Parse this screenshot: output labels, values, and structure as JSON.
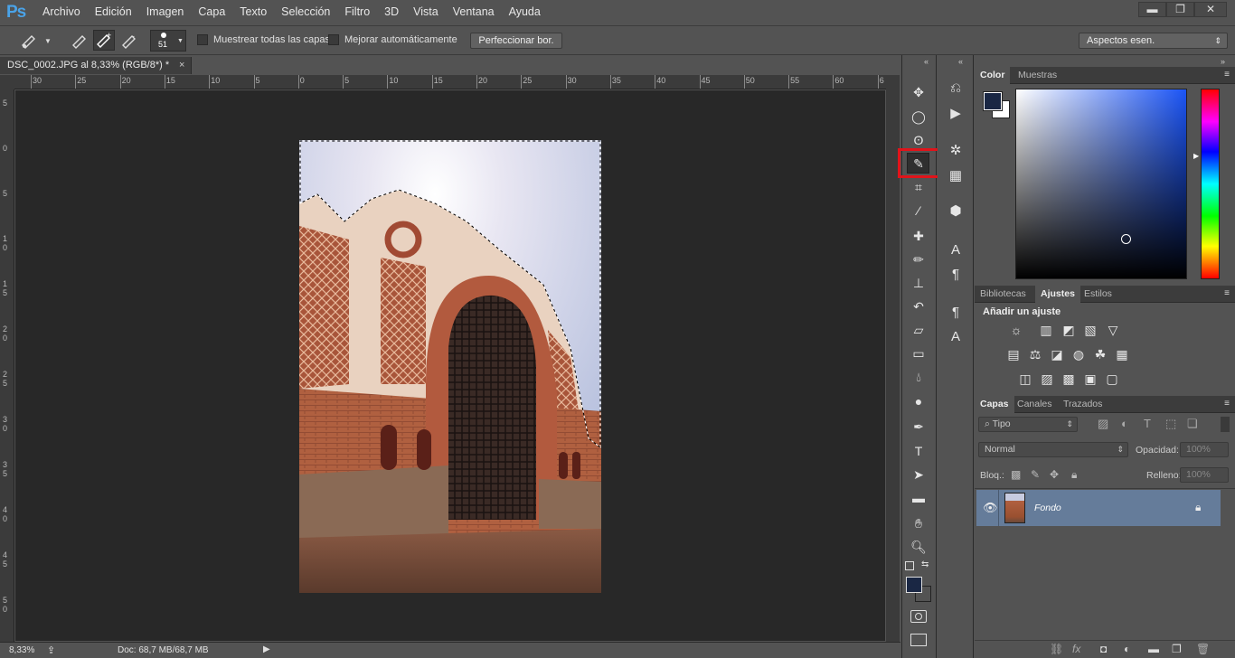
{
  "app": {
    "logo": "Ps"
  },
  "menu": [
    "Archivo",
    "Edición",
    "Imagen",
    "Capa",
    "Texto",
    "Selección",
    "Filtro",
    "3D",
    "Vista",
    "Ventana",
    "Ayuda"
  ],
  "window_controls": {
    "minimize": "▬",
    "restore": "❐",
    "close": "✕"
  },
  "options": {
    "brush_size": "51",
    "sample_all_layers": "Muestrear todas las capas",
    "auto_enhance": "Mejorar automáticamente",
    "refine_edge": "Perfeccionar bor.",
    "workspace": "Aspectos esen."
  },
  "document": {
    "tab_title": "DSC_0002.JPG al 8,33% (RGB/8*) *",
    "close": "×",
    "zoom": "8,33%",
    "doc_info": "Doc: 68,7 MB/68,7 MB"
  },
  "rulers": {
    "h_labels": [
      "30",
      "25",
      "20",
      "15",
      "10",
      "5",
      "0",
      "5",
      "10",
      "15",
      "20",
      "25",
      "30",
      "35",
      "40",
      "45",
      "50",
      "55",
      "60",
      "6"
    ],
    "v_labels": [
      "5",
      "0",
      "5",
      "1\n0",
      "1\n5",
      "2\n0",
      "2\n5",
      "3\n0",
      "3\n5",
      "4\n0",
      "4\n5",
      "5\n0",
      "5"
    ]
  },
  "tools": [
    "move-icon",
    "elliptical-marquee-icon",
    "lasso-icon",
    "quick-selection-icon",
    "crop-icon",
    "eyedropper-icon",
    "healing-brush-icon",
    "brush-icon",
    "clone-stamp-icon",
    "history-brush-icon",
    "eraser-icon",
    "gradient-icon",
    "blur-icon",
    "dodge-icon",
    "pen-icon",
    "type-icon",
    "path-selection-icon",
    "rectangle-icon",
    "hand-icon",
    "zoom-icon"
  ],
  "colors": {
    "foreground": "#1a2744",
    "background": "#ffffff",
    "highlight": "#e1131a",
    "picker_hue": "#1b54f5",
    "layer_selected": "#657c9a"
  },
  "panels": {
    "color_tabs": [
      "Color",
      "Muestras"
    ],
    "adjust_tabs": [
      "Bibliotecas",
      "Ajustes",
      "Estilos"
    ],
    "add_adjustment": "Añadir un ajuste",
    "layers_tabs": [
      "Capas",
      "Canales",
      "Trazados"
    ],
    "filter_kind": "Tipo",
    "blend_mode": "Normal",
    "opacity_label": "Opacidad:",
    "opacity_value": "100%",
    "lock_label": "Bloq.:",
    "fill_label": "Relleno:",
    "fill_value": "100%",
    "layer_name": "Fondo"
  }
}
